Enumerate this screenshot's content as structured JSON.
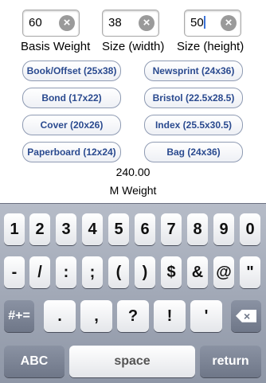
{
  "fields": [
    {
      "value": "60",
      "label": "Basis Weight"
    },
    {
      "value": "38",
      "label": "Size (width)"
    },
    {
      "value": "50",
      "label": "Size (height)"
    }
  ],
  "presets": [
    "Book/Offset (25x38)",
    "Newsprint (24x36)",
    "Bond (17x22)",
    "Bristol (22.5x28.5)",
    "Cover  (20x26)",
    "Index (25.5x30.5)",
    "Paperboard (12x24)",
    "Bag (24x36)"
  ],
  "result": {
    "value": "240.00",
    "label": "M Weight"
  },
  "keyboard": {
    "row1": [
      "1",
      "2",
      "3",
      "4",
      "5",
      "6",
      "7",
      "8",
      "9",
      "0"
    ],
    "row2": [
      "-",
      "/",
      ":",
      ";",
      "(",
      ")",
      "$",
      "&",
      "@",
      "\""
    ],
    "row3": [
      ".",
      ",",
      "?",
      "!",
      "'"
    ],
    "symbols_key": "#+=",
    "abc_key": "ABC",
    "space_key": "space",
    "return_key": "return"
  },
  "icons": {
    "clear": "clear-circle-icon",
    "backspace": "backspace-icon"
  }
}
